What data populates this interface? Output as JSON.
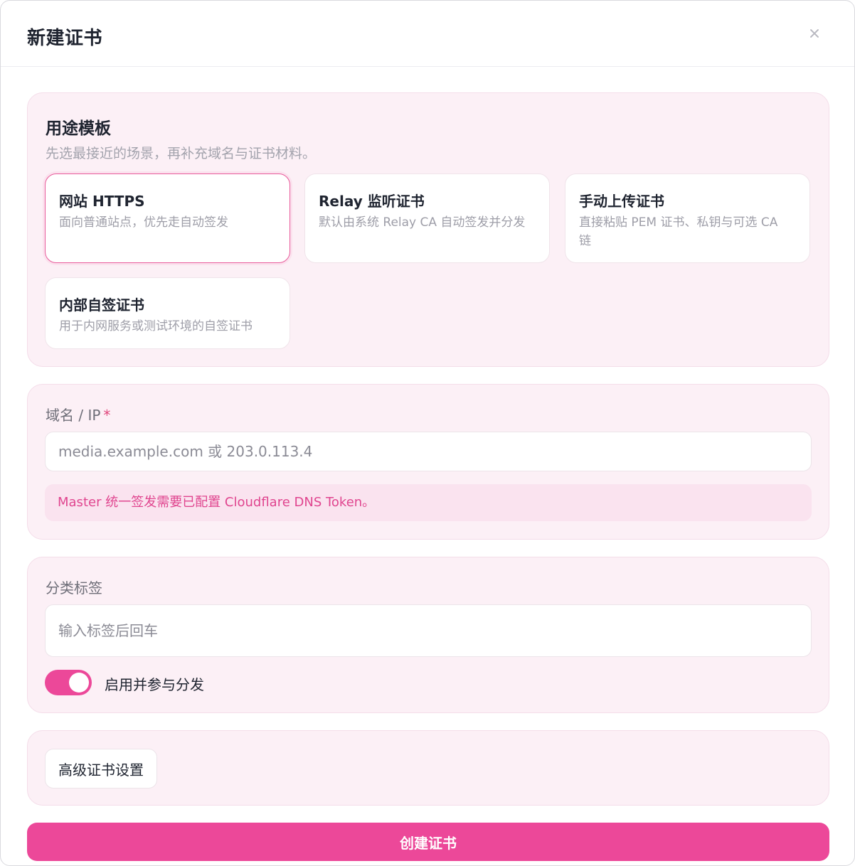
{
  "dialog": {
    "title": "新建证书",
    "close_icon": "close-icon"
  },
  "templates": {
    "title": "用途模板",
    "description": "先选最接近的场景，再补充域名与证书材料。",
    "selected_index": 0,
    "items": [
      {
        "name": "网站 HTTPS",
        "description": "面向普通站点，优先走自动签发"
      },
      {
        "name": "Relay 监听证书",
        "description": "默认由系统 Relay CA 自动签发并分发"
      },
      {
        "name": "手动上传证书",
        "description": "直接粘贴 PEM 证书、私钥与可选 CA 链"
      },
      {
        "name": "内部自签证书",
        "description": "用于内网服务或测试环境的自签证书"
      }
    ]
  },
  "domain": {
    "label": "域名 / IP",
    "required_mark": "*",
    "value": "",
    "placeholder": "media.example.com 或 203.0.113.4",
    "notice": "Master 统一签发需要已配置 Cloudflare DNS Token。"
  },
  "tags": {
    "label": "分类标签",
    "value": "",
    "placeholder": "输入标签后回车",
    "toggle_on": true,
    "toggle_label": "启用并参与分发"
  },
  "advanced": {
    "button_label": "高级证书设置"
  },
  "submit": {
    "label": "创建证书"
  },
  "colors": {
    "accent": "#ec4899",
    "panel_bg": "#fcf0f6",
    "notice_text": "#e0458f"
  }
}
